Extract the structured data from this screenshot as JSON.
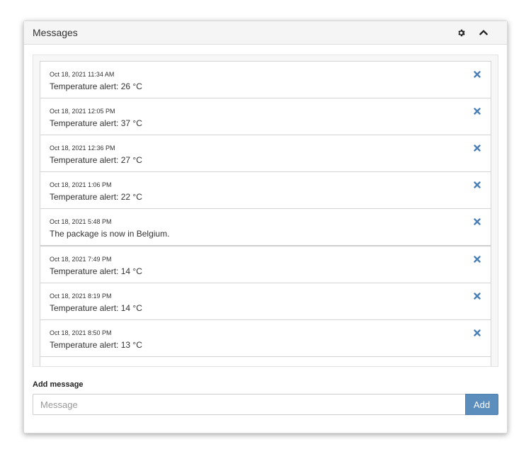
{
  "panel": {
    "title": "Messages",
    "settings_icon": "gear-icon",
    "collapse_icon": "chevron-up-icon"
  },
  "messages": [
    {
      "time": "Oct 18, 2021 11:34 AM",
      "text": "Temperature alert: 26 °C"
    },
    {
      "time": "Oct 18, 2021 12:05 PM",
      "text": "Temperature alert: 37 °C"
    },
    {
      "time": "Oct 18, 2021 12:36 PM",
      "text": "Temperature alert: 27 °C"
    },
    {
      "time": "Oct 18, 2021 1:06 PM",
      "text": "Temperature alert: 22 °C"
    },
    {
      "time": "Oct 18, 2021 5:48 PM",
      "text": "The package is now in Belgium."
    },
    {
      "time": "Oct 18, 2021 7:49 PM",
      "text": "Temperature alert: 14 °C"
    },
    {
      "time": "Oct 18, 2021 8:19 PM",
      "text": "Temperature alert: 14 °C"
    },
    {
      "time": "Oct 18, 2021 8:50 PM",
      "text": "Temperature alert: 13 °C"
    }
  ],
  "add_message": {
    "label": "Add message",
    "placeholder": "Message",
    "value": "",
    "button_label": "Add"
  },
  "colors": {
    "accent": "#5b8dbd",
    "close_icon": "#4a7fb5",
    "header_bg": "#f5f5f5"
  }
}
